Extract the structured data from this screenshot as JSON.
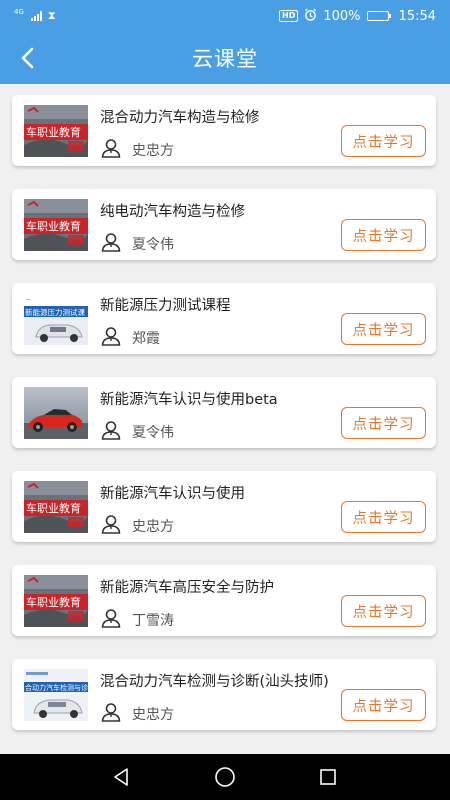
{
  "status_bar": {
    "network": "4G",
    "hd": "HD",
    "battery": "100%",
    "battery_level": 1.0,
    "time": "15:54"
  },
  "header": {
    "title": "云课堂"
  },
  "study_label": "点击学习",
  "courses": [
    {
      "title": "混合动力汽车构造与检修",
      "teacher": "史忠方",
      "thumb": "auto-vocational",
      "thumb_text": "车职业教育"
    },
    {
      "title": "纯电动汽车构造与检修",
      "teacher": "夏令伟",
      "thumb": "auto-vocational",
      "thumb_text": "车职业教育"
    },
    {
      "title": "新能源压力测试课程",
      "teacher": "郑霞",
      "thumb": "pressure-test",
      "thumb_text": "新能源压力测试课"
    },
    {
      "title": "新能源汽车认识与使用beta",
      "teacher": "夏令伟",
      "thumb": "red-sportscar",
      "thumb_text": ""
    },
    {
      "title": "新能源汽车认识与使用",
      "teacher": "史忠方",
      "thumb": "auto-vocational",
      "thumb_text": "车职业教育"
    },
    {
      "title": "新能源汽车高压安全与防护",
      "teacher": "丁雪涛",
      "thumb": "auto-vocational",
      "thumb_text": "车职业教育"
    },
    {
      "title": "混合动力汽车检测与诊断(汕头技师)",
      "teacher": "史忠方",
      "thumb": "hybrid-diagnosis",
      "thumb_text": "合动力汽车检测与诊"
    }
  ],
  "colors": {
    "primary": "#4a9fe4",
    "accent": "#e07a2e"
  }
}
